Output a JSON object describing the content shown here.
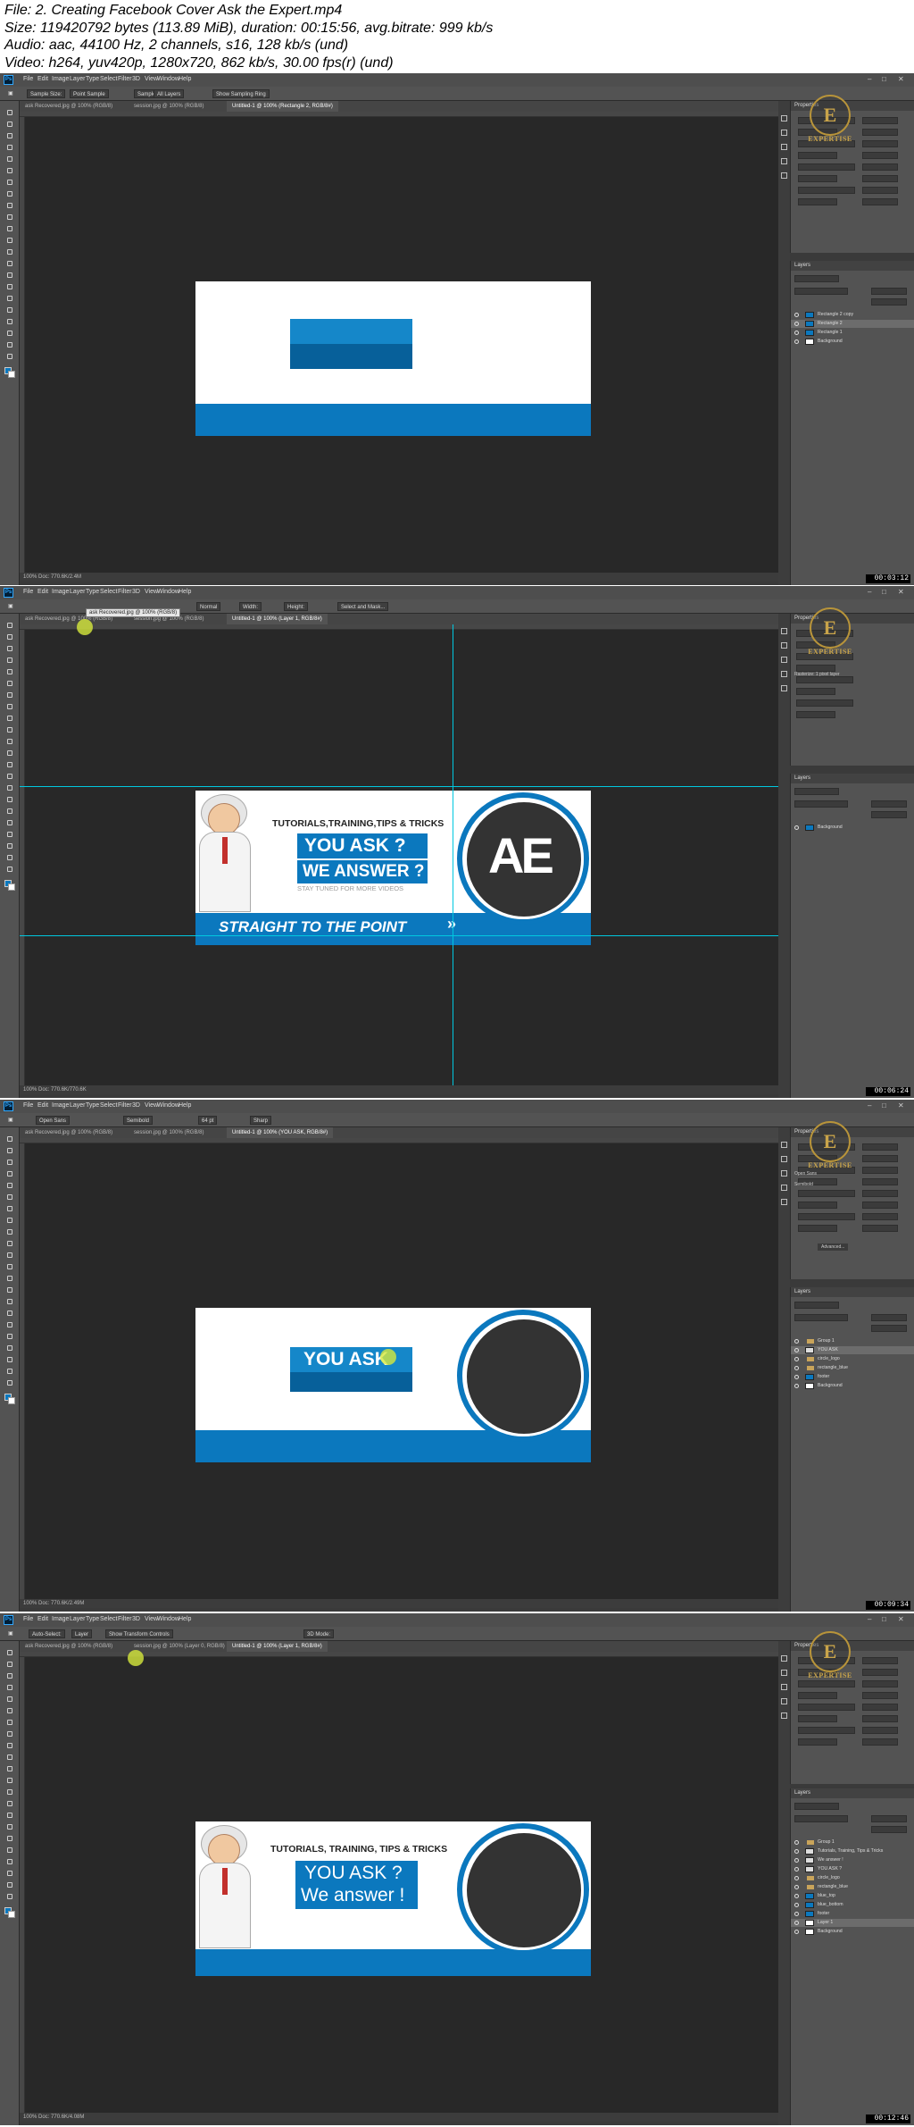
{
  "info": {
    "line1": "File: 2. Creating Facebook Cover Ask the Expert.mp4",
    "line2": "Size: 119420792 bytes (113.89 MiB), duration: 00:15:56, avg.bitrate: 999 kb/s",
    "line3": "Audio: aac, 44100 Hz, 2 channels, s16, 128 kb/s (und)",
    "line4": "Video: h264, yuv420p, 1280x720, 862 kb/s, 30.00 fps(r) (und)"
  },
  "menu": [
    "File",
    "Edit",
    "Image",
    "Layer",
    "Type",
    "Select",
    "Filter",
    "3D",
    "View",
    "Window",
    "Help"
  ],
  "watermark": {
    "letter": "E",
    "text": "EXPERTISE"
  },
  "frames": [
    {
      "timestamp": "00:03:12",
      "options": [
        "Sample Size:",
        "Point Sample",
        "Sample:",
        "All Layers",
        "Show Sampling Ring"
      ],
      "tabs": [
        "ask Recovered.jpg @ 100% (RGB/8)",
        "session.jpg @ 100% (RGB/8)",
        "Untitled-1 @ 100% (Rectangle 2, RGB/8#)"
      ],
      "status": "100%     Doc: 770.6K/2.4M",
      "panel_title": "Properties",
      "layers_title": "Layers",
      "layers": [
        {
          "name": "Rectangle 2 copy",
          "kind": "blue",
          "selected": false
        },
        {
          "name": "Rectangle 2",
          "kind": "blue",
          "selected": true
        },
        {
          "name": "Rectangle 1",
          "kind": "blue",
          "selected": false
        },
        {
          "name": "Background",
          "kind": "white",
          "selected": false
        }
      ]
    },
    {
      "timestamp": "00:06:24",
      "options": [
        "Normal",
        "Width:",
        "Height:",
        "Select and Mask..."
      ],
      "tabs": [
        "ask Recovered.jpg @ 100% (RGB/8)",
        "session.jpg @ 100% (RGB/8)",
        "Untitled-1 @ 100% (Layer 1, RGB/8#)"
      ],
      "tooltip": "ask Recovered.jpg @ 100% (RGB/8)",
      "status": "100%     Doc: 770.6K/770.6K",
      "panel_title": "Properties",
      "panel_note": "Rasterize: 1 pixel layer",
      "layers_title": "Layers",
      "layers": [
        {
          "name": "Background",
          "kind": "cover",
          "selected": false
        }
      ],
      "cover": {
        "heading": "TUTORIALS,TRAINING,TIPS & TRICKS",
        "ask1": "YOU ASK ?",
        "ask2": "WE ANSWER ?",
        "stay": "STAY TUNED FOR MORE VIDEOS",
        "point": "STRAIGHT TO THE POINT",
        "logo": "AE"
      }
    },
    {
      "timestamp": "00:09:34",
      "options": [
        "Open Sans",
        "Semibold",
        "64 pt",
        "Sharp"
      ],
      "tabs": [
        "ask Recovered.jpg @ 100% (RGB/8)",
        "session.jpg @ 100% (RGB/8)",
        "Untitled-1 @ 100% (YOU ASK, RGB/8#)"
      ],
      "status": "100%     Doc: 770.6K/2.49M",
      "panel_title": "Properties",
      "panel_font": "Open Sans",
      "panel_style": "Semibold",
      "panel_button": "Advanced...",
      "layers_title": "Layers",
      "layers": [
        {
          "name": "Group 1",
          "kind": "folder",
          "selected": false
        },
        {
          "name": "YOU ASK",
          "kind": "text",
          "selected": true
        },
        {
          "name": "circle_logo",
          "kind": "folder",
          "selected": false
        },
        {
          "name": "rectangle_blue",
          "kind": "folder",
          "selected": false
        },
        {
          "name": "footer",
          "kind": "blue",
          "selected": false
        },
        {
          "name": "Background",
          "kind": "white",
          "selected": false
        }
      ],
      "cover": {
        "ask1": "YOU ASK"
      }
    },
    {
      "timestamp": "00:12:46",
      "options": [
        "Auto-Select:",
        "Layer",
        "Show Transform Controls",
        "3D Mode:"
      ],
      "tabs": [
        "ask Recovered.jpg @ 100% (RGB/8)",
        "session.jpg @ 100% (Layer 0, RGB/8)",
        "Untitled-1 @ 100% (Layer 1, RGB/8#)"
      ],
      "status": "100%     Doc: 770.6K/4.08M",
      "panel_title": "Properties",
      "layers_title": "Layers",
      "layers": [
        {
          "name": "Group 1",
          "kind": "folder",
          "selected": false
        },
        {
          "name": "Tutorials, Training, Tips & Tricks",
          "kind": "text",
          "selected": false
        },
        {
          "name": "We answer !",
          "kind": "text",
          "selected": false
        },
        {
          "name": "YOU ASK ?",
          "kind": "text",
          "selected": false
        },
        {
          "name": "circle_logo",
          "kind": "folder",
          "selected": false
        },
        {
          "name": "rectangle_blue",
          "kind": "folder",
          "selected": false
        },
        {
          "name": "blue_top",
          "kind": "blue",
          "selected": false
        },
        {
          "name": "blue_bottom",
          "kind": "blue",
          "selected": false
        },
        {
          "name": "footer",
          "kind": "blue",
          "selected": false
        },
        {
          "name": "Layer 1",
          "kind": "white",
          "selected": true
        },
        {
          "name": "Background",
          "kind": "white",
          "selected": false
        }
      ],
      "cover": {
        "heading": "TUTORIALS, TRAINING, TIPS & TRICKS",
        "ask1": "YOU ASK ?",
        "ask2": "We answer !"
      }
    }
  ]
}
